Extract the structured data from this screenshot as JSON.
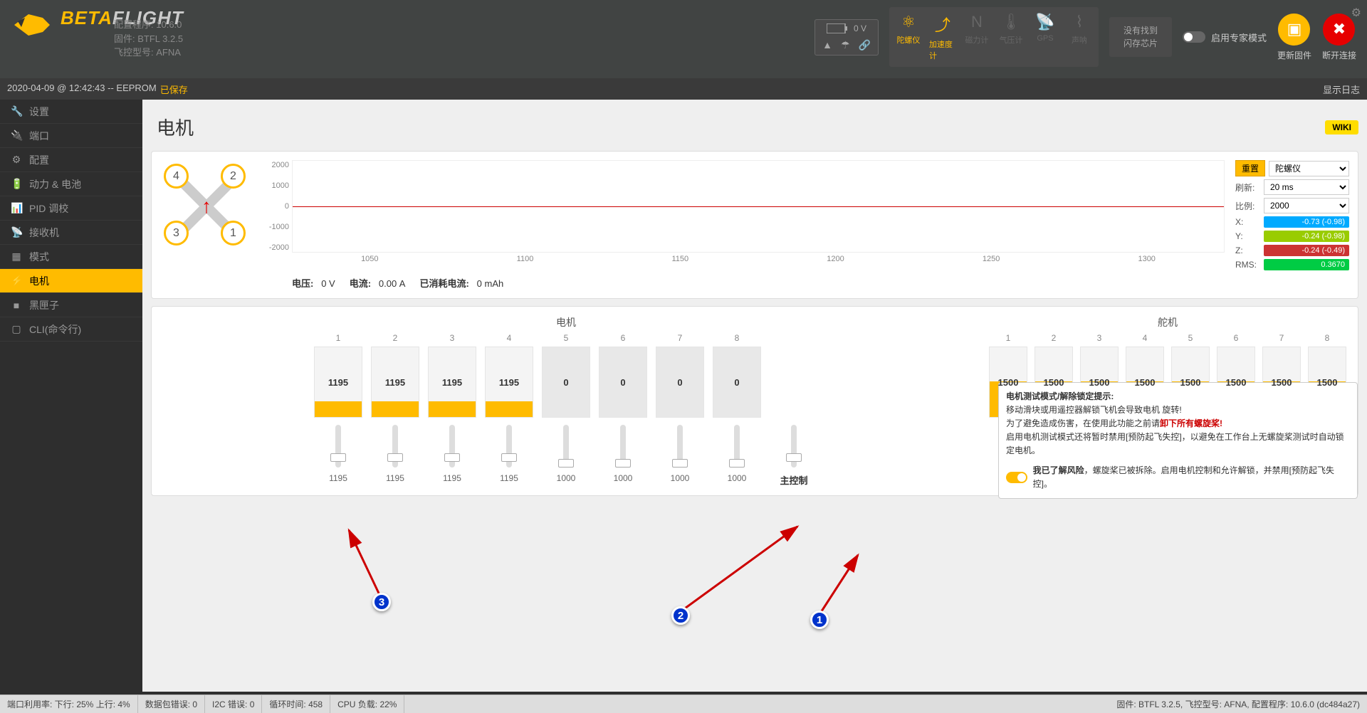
{
  "header": {
    "logo_beta": "BETA",
    "logo_flight": "FLIGHT",
    "config_version_label": "配置程序:",
    "config_version": "10.6.0",
    "firmware_label": "固件:",
    "firmware": "BTFL 3.2.5",
    "target_label": "飞控型号:",
    "target": "AFNA",
    "battery_voltage": "0 V",
    "sensors": {
      "gyro": "陀螺仪",
      "accel": "加速度计",
      "mag": "磁力计",
      "baro": "气压计",
      "gps": "GPS",
      "sonar": "声呐"
    },
    "dataflash_line1": "没有找到",
    "dataflash_line2": "闪存芯片",
    "expert_mode": "启用专家模式",
    "update_firmware": "更新固件",
    "disconnect": "断开连接"
  },
  "status_bar": {
    "timestamp": "2020-04-09 @ 12:42:43 -- EEPROM",
    "saved": "已保存",
    "show_log": "显示日志"
  },
  "sidebar": {
    "items": [
      {
        "icon": "🔧",
        "label": "设置"
      },
      {
        "icon": "🔌",
        "label": "端口"
      },
      {
        "icon": "⚙",
        "label": "配置"
      },
      {
        "icon": "🔋",
        "label": "动力 & 电池"
      },
      {
        "icon": "📊",
        "label": "PID 调校"
      },
      {
        "icon": "📡",
        "label": "接收机"
      },
      {
        "icon": "▦",
        "label": "模式"
      },
      {
        "icon": "⚡",
        "label": "电机"
      },
      {
        "icon": "■",
        "label": "黑匣子"
      },
      {
        "icon": "▢",
        "label": "CLI(命令行)"
      }
    ]
  },
  "content": {
    "title": "电机",
    "wiki": "WIKI"
  },
  "graph": {
    "y_labels": [
      "2000",
      "1000",
      "0",
      "-1000",
      "-2000"
    ],
    "x_labels": [
      "1050",
      "1100",
      "1150",
      "1200",
      "1250",
      "1300"
    ],
    "voltage_label": "电压:",
    "voltage": "0 V",
    "current_label": "电流:",
    "current": "0.00 A",
    "mah_label": "已消耗电流:",
    "mah": "0 mAh",
    "reset": "重置",
    "sensor_select": "陀螺仪",
    "refresh_label": "刷新:",
    "refresh": "20 ms",
    "scale_label": "比例:",
    "scale": "2000",
    "x_label": "X:",
    "x_val": "-0.73 (-0.98)",
    "y_label": "Y:",
    "y_val": "-0.24 (-0.98)",
    "z_label": "Z:",
    "z_val": "-0.24 (-0.49)",
    "rms_label": "RMS:",
    "rms_val": "0.3670"
  },
  "motors": {
    "section_title": "电机",
    "nums": [
      "1",
      "2",
      "3",
      "4",
      "5",
      "6",
      "7",
      "8"
    ],
    "values": [
      "1195",
      "1195",
      "1195",
      "1195",
      "0",
      "0",
      "0",
      "0"
    ],
    "slider_vals": [
      "1195",
      "1195",
      "1195",
      "1195",
      "1000",
      "1000",
      "1000",
      "1000"
    ],
    "master_label": "主控制"
  },
  "servos": {
    "section_title": "舵机",
    "nums": [
      "1",
      "2",
      "3",
      "4",
      "5",
      "6",
      "7",
      "8"
    ],
    "values": [
      "1500",
      "1500",
      "1500",
      "1500",
      "1500",
      "1500",
      "1500",
      "1500"
    ]
  },
  "warning": {
    "title": "电机测试模式/解除锁定提示:",
    "line1": "移动滑块或用遥控器解锁飞机会导致电机 旋转!",
    "line2a": "为了避免造成伤害，在使用此功能之前请",
    "line2b": "卸下所有螺旋桨!",
    "line3": "启用电机测试模式还将暂时禁用[预防起飞失控]，以避免在工作台上无螺旋桨测试时自动锁定电机。",
    "check_label": "我已了解风险",
    "check_suffix": "，螺旋桨已被拆除。启用电机控制和允许解锁，并禁用[预防起飞失控]。"
  },
  "callouts": {
    "c1": "1",
    "c2": "2",
    "c3": "3"
  },
  "footer": {
    "port_util": "端口利用率:  下行: 25% 上行: 4%",
    "packet_err": "数据包错误: 0",
    "i2c_err": "I2C 错误: 0",
    "cycle": "循环时间: 458",
    "cpu": "CPU 负载: 22%",
    "right": "固件: BTFL 3.2.5, 飞控型号: AFNA, 配置程序: 10.6.0 (dc484a27)"
  }
}
